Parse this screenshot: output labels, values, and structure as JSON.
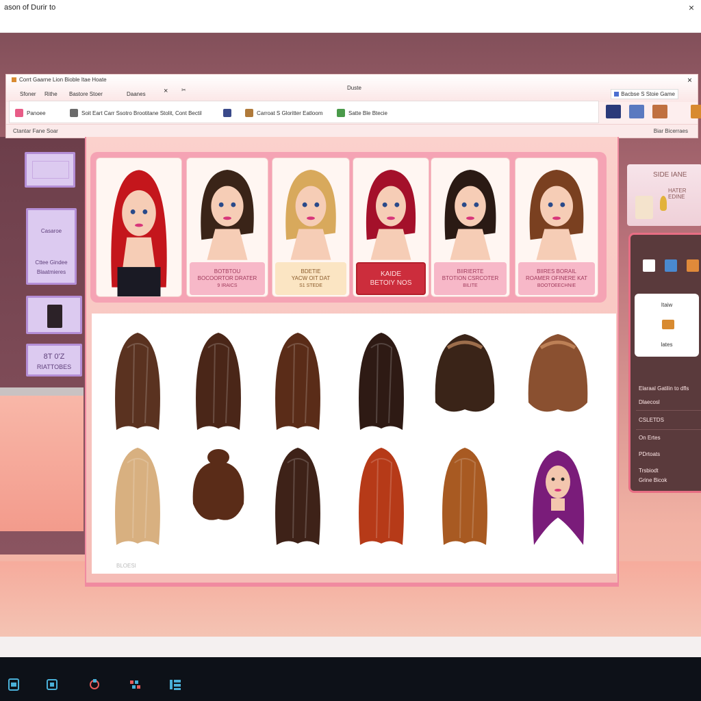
{
  "os": {
    "title": "ason of Durir to",
    "close": "×"
  },
  "app": {
    "name": "Corrt Gaarne Lion Bioble Itae Hoate",
    "caption": "Duste",
    "tabs": [
      "Sfoner",
      "Rithe",
      "Bastore Stoer",
      "Daanes"
    ],
    "tab_close": "×",
    "tab_extra": "✂",
    "window_close": "×",
    "right_tag": "Bacbse S Stoie Game",
    "toolbar": [
      {
        "label": "Panoee",
        "icon": "palette-icon",
        "color": "#e85c87"
      },
      {
        "label": "Soit Eart Carr Ssotro Brootitane Stolit, Cont Bectil",
        "icon": "scissors-icon",
        "color": "#6a6a6a"
      },
      {
        "label": "",
        "icon": "phone-icon",
        "color": "#3a4a8a"
      },
      {
        "label": "Carroat S Gloritter Eatloom",
        "icon": "brush-icon",
        "color": "#b07a3a"
      },
      {
        "label": "Satte Ble Btecie",
        "icon": "scissors-green-icon",
        "color": "#4a9a4a"
      }
    ],
    "status_left": "Ctantar Fane Soar",
    "status_right": "Biar Bicerraes"
  },
  "room": {
    "card1": "",
    "card2_l1": "Casaroe",
    "card2_l2": "Cttee Gindee",
    "card2_l3": "Blaatmieres",
    "card4_l1": "8T 0'Z",
    "card4_l2": "RIATTOBES",
    "sign_a": "SIDE IANE",
    "sign_b": "HATER EDINE"
  },
  "styles": [
    {
      "name": "red-long",
      "l1": "",
      "l2": "",
      "l3": "",
      "hair": "#c4161c",
      "variant": "pink"
    },
    {
      "name": "brown-bob",
      "l1": "BOTBTOU",
      "l2": "BOCOORTOR DRATER",
      "l3": "9 IRAICS",
      "hair": "#3a2418",
      "variant": "pink"
    },
    {
      "name": "blonde-bob",
      "l1": "BDETIE",
      "l2": "YACW OIT DAT",
      "l3": "S1 STEDE",
      "hair": "#d8a95c",
      "variant": "gold"
    },
    {
      "name": "crimson-bob",
      "l1": "KAIDE",
      "l2": "BETOIY NOS",
      "l3": "",
      "hair": "#a4102a",
      "variant": "selected"
    },
    {
      "name": "dark-wavy",
      "l1": "BIIRIERTE",
      "l2": "BTOTION CSRCOTER",
      "l3": "BILITE",
      "hair": "#2a1a14",
      "variant": "pink"
    },
    {
      "name": "auburn-pony",
      "l1": "BIIRES BORAIL",
      "l2": "ROAMER OFINERE KAT",
      "l3": "BOOTOEECHNIE",
      "hair": "#7a4020",
      "variant": "pink"
    }
  ],
  "hair_grid": {
    "caption": "BLOESI",
    "items": [
      {
        "name": "brown-straight-short",
        "color": "#5a3220"
      },
      {
        "name": "brown-straight-long",
        "color": "#4a2618"
      },
      {
        "name": "brown-straight-middle",
        "color": "#5a2c18"
      },
      {
        "name": "dark-brown-long",
        "color": "#2e1a14"
      },
      {
        "name": "dark-wavy-long",
        "color": "#3a2418"
      },
      {
        "name": "ombre-bob",
        "color": "#8a5030"
      },
      {
        "name": "blonde-ombre",
        "color": "#d8b080"
      },
      {
        "name": "brown-bun",
        "color": "#5a2c18"
      },
      {
        "name": "brown-v-cut",
        "color": "#3e2218"
      },
      {
        "name": "copper-long",
        "color": "#b63a18"
      },
      {
        "name": "chestnut-long",
        "color": "#a85a22"
      },
      {
        "name": "purple-model",
        "color": "#7a1c7a"
      }
    ]
  },
  "right_panel": {
    "card_t1": "Itaiw",
    "card_t2": "lates",
    "menu": [
      "Elaraal Gatilin to dfls",
      "Dlaecosl",
      "CSLETDS",
      "On Ertes",
      "PDrtoats",
      "Trsbiodt",
      "Grine Bicok"
    ]
  },
  "taskbar": [
    "file-icon",
    "folder-icon",
    "refresh-icon",
    "apps-icon",
    "grid-icon"
  ]
}
